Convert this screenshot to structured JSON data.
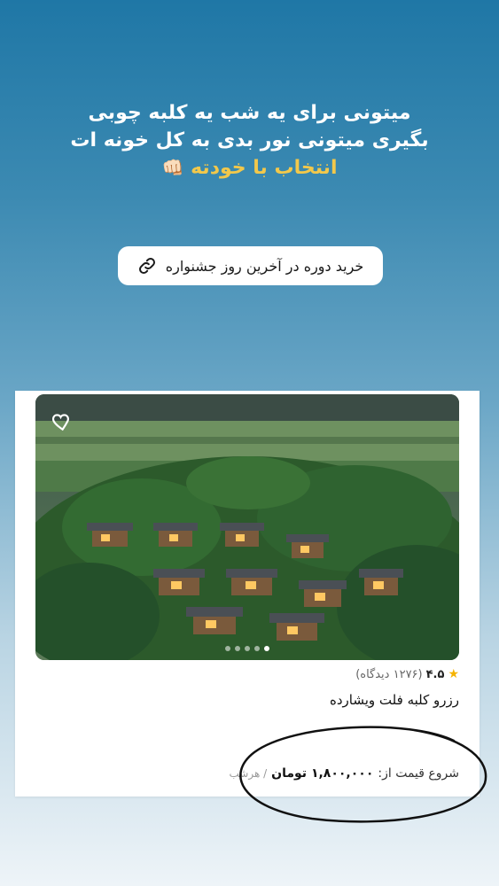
{
  "story": {
    "line1": "میتونی برای یه شب یه کلبه چوبی",
    "line2": "بگیری میتونی نور بدی به کل خونه ات",
    "line3": "انتخاب با خودته",
    "emoji": "👊🏻"
  },
  "link_sticker": {
    "label": "خرید دوره در آخرین روز جشنواره",
    "icon": "link-icon"
  },
  "listing": {
    "rating": "۴.۵",
    "reviews": "(۱۲۷۶ دیدگاه)",
    "title": "رزرو کلبه فلت ویشارده",
    "price_prefix": "شروع قیمت از:",
    "price": "۱,۸۰۰,۰۰۰ تومان",
    "price_unit": "/ هرشب",
    "carousel_dots": 5,
    "active_dot": 1
  },
  "colors": {
    "accent_yellow": "#f2c84b",
    "star": "#f5b301"
  }
}
